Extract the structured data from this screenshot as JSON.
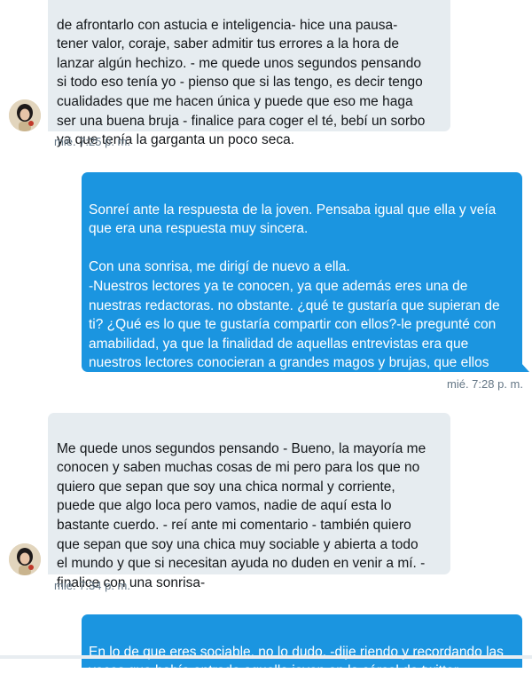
{
  "conversation": {
    "messages": [
      {
        "sender": "other",
        "text": "de afrontarlo con astucia e inteligencia- hice una pausa-\ntener valor, coraje, saber admitir tus errores a la hora de\nlanzar algún hechizo. - me quede unos segundos pensando\nsi todo eso  tenía yo - pienso que si las tengo, es decir tengo\ncualidades que me hacen única y puede que eso me haga\nser una buena bruja - finalice para coger el té, bebí un sorbo\nya que tenía la garganta un poco seca.",
        "timestamp": "mié. 7:25 p. m."
      },
      {
        "sender": "me",
        "text": "Sonreí ante la respuesta de la joven. Pensaba igual que ella y veía\nque era una respuesta muy sincera.\n\nCon una sonrisa, me dirigí de nuevo a ella.\n-Nuestros lectores ya te conocen, ya que además eres una de\nnuestras redactoras. no obstante. ¿qué te gustaría que supieran de\nti? ¿Qué es lo que te gustaría compartir con ellos?-le pregunté con\namabilidad, ya que la finalidad de aquellas entrevistas era que\nnuestros lectores conocieran a grandes magos y brujas, que ellos\nmismos votaban.",
        "timestamp": "mié. 7:28 p. m."
      },
      {
        "sender": "other",
        "text": "Me quede unos segundos pensando - Bueno, la mayoría me\nconocen y saben muchas cosas de mi pero para los que no\nquiero que sepan que soy una chica normal y corriente,\npuede que algo loca pero vamos, nadie de aquí esta lo\nbastante cuerdo. - reí ante mi comentario - también quiero\nque sepan que soy una chica muy sociable y abierta a todo\nel mundo y que si necesitan ayuda no duden en venir a mí. -\nfinalice con una sonrisa-",
        "timestamp": "mié. 7:34 p. m."
      },
      {
        "sender": "me",
        "text": "En lo de que eres sociable, no lo dudo. -dije riendo y recordando las\nveces que había entrado aquella joven en la cárcel de twitter."
      }
    ]
  },
  "colors": {
    "incoming_bubble": "#e6ecf0",
    "outgoing_bubble": "#1b95e0",
    "timestamp_text": "#657786"
  }
}
